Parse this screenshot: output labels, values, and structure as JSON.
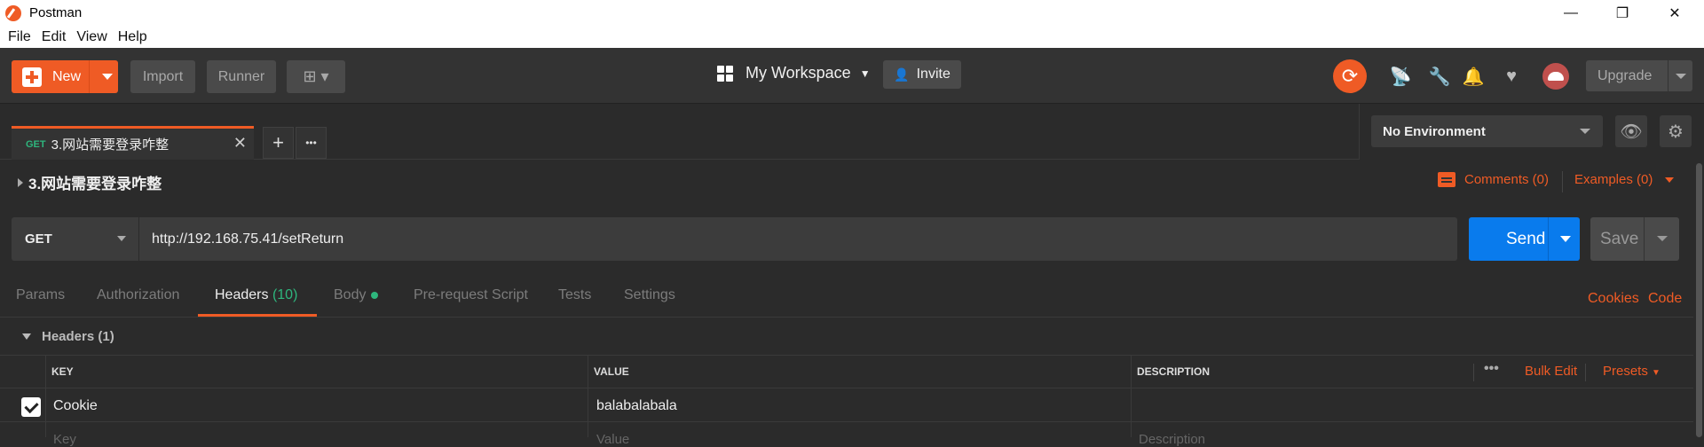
{
  "window": {
    "title": "Postman",
    "controls": [
      "—",
      "❐",
      "✕"
    ]
  },
  "menu": [
    "File",
    "Edit",
    "View",
    "Help"
  ],
  "toolbar": {
    "new_label": "New",
    "import_label": "Import",
    "runner_label": "Runner",
    "workspace_label": "My Workspace",
    "invite_label": "Invite",
    "upgrade_label": "Upgrade",
    "accent": "#ef5b25"
  },
  "tab": {
    "method": "GET",
    "name": "3.网站需要登录咋整",
    "close": "✕",
    "add": "+",
    "more": "•••"
  },
  "environment": {
    "selected": "No Environment"
  },
  "request": {
    "name": "3.网站需要登录咋整",
    "comments_label": "Comments (0)",
    "examples_label": "Examples (0)",
    "method": "GET",
    "url": "http://192.168.75.41/setReturn",
    "send_label": "Send",
    "save_label": "Save"
  },
  "subtabs": {
    "params": "Params",
    "authorization": "Authorization",
    "headers": "Headers",
    "headers_count": "(10)",
    "body": "Body",
    "prerequest": "Pre-request Script",
    "tests": "Tests",
    "settings": "Settings",
    "cookies": "Cookies",
    "code": "Code"
  },
  "headers_section": {
    "title": "Headers (1)",
    "columns": {
      "key": "KEY",
      "value": "VALUE",
      "description": "DESCRIPTION"
    },
    "more": "•••",
    "bulk_edit": "Bulk Edit",
    "presets": "Presets",
    "rows": [
      {
        "checked": true,
        "key": "Cookie",
        "value": "balabalabala",
        "description": ""
      }
    ],
    "placeholders": {
      "key": "Key",
      "value": "Value",
      "description": "Description"
    }
  }
}
